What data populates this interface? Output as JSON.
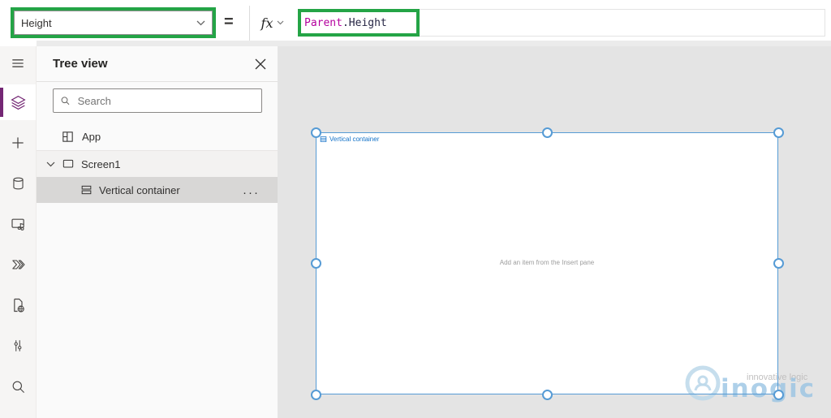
{
  "formula_bar": {
    "property": "Height",
    "equals": "=",
    "fx_label": "fx",
    "formula_identifier": "Parent",
    "formula_rest": ".Height"
  },
  "sidebar": {
    "items": [
      "menu",
      "tree-view",
      "insert",
      "data",
      "media",
      "power-automate",
      "advanced-tools",
      "settings",
      "search"
    ]
  },
  "tree_panel": {
    "title": "Tree view",
    "search_placeholder": "Search",
    "items": {
      "app": "App",
      "screen": "Screen1",
      "container": "Vertical container"
    },
    "more": "···"
  },
  "canvas": {
    "selection_label": "Vertical container",
    "empty_hint": "Add an item from the Insert pane",
    "watermark_tagline": "innovative logic",
    "watermark_brand": "inogic"
  },
  "colors": {
    "annotation_green": "#24a446",
    "selection_blue": "#569bd5",
    "accent_purple": "#742774",
    "formula_identifier_magenta": "#b4009e",
    "canvas_gray": "#e4e4e4"
  }
}
